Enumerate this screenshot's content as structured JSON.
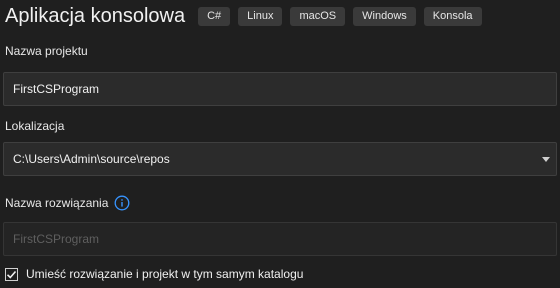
{
  "header": {
    "title": "Aplikacja konsolowa",
    "tags": [
      "C#",
      "Linux",
      "macOS",
      "Windows",
      "Konsola"
    ]
  },
  "project_name": {
    "label": "Nazwa projektu",
    "value": "FirstCSProgram"
  },
  "location": {
    "label": "Lokalizacja",
    "value": "C:\\Users\\Admin\\source\\repos"
  },
  "solution_name": {
    "label": "Nazwa rozwiązania",
    "placeholder": "FirstCSProgram",
    "info_icon": "info-icon"
  },
  "same_directory": {
    "label": "Umieść rozwiązanie i projekt w tym samym katalogu",
    "checked": true
  },
  "colors": {
    "background": "#1f1f1f",
    "tag_background": "#3a3a3a",
    "field_background": "#2b2b2b",
    "accent": "#3794ff"
  }
}
